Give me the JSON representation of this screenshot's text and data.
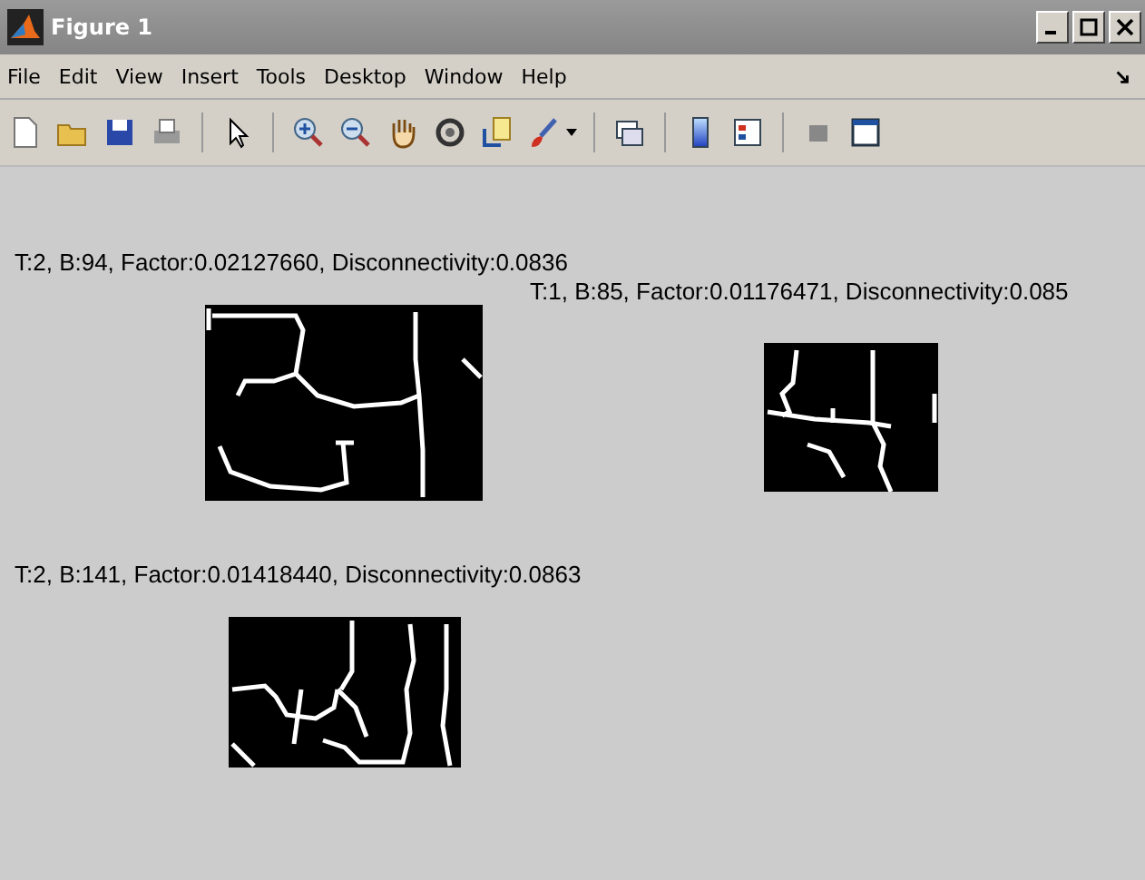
{
  "window": {
    "title": "Figure 1"
  },
  "menu": [
    "File",
    "Edit",
    "View",
    "Insert",
    "Tools",
    "Desktop",
    "Window",
    "Help"
  ],
  "plots": [
    {
      "title": "T:2, B:94, Factor:0.02127660, Disconnectivity:0.0836"
    },
    {
      "title": "T:1, B:85, Factor:0.01176471, Disconnectivity:0.085"
    },
    {
      "title": "T:2, B:141, Factor:0.01418440, Disconnectivity:0.0863"
    }
  ]
}
